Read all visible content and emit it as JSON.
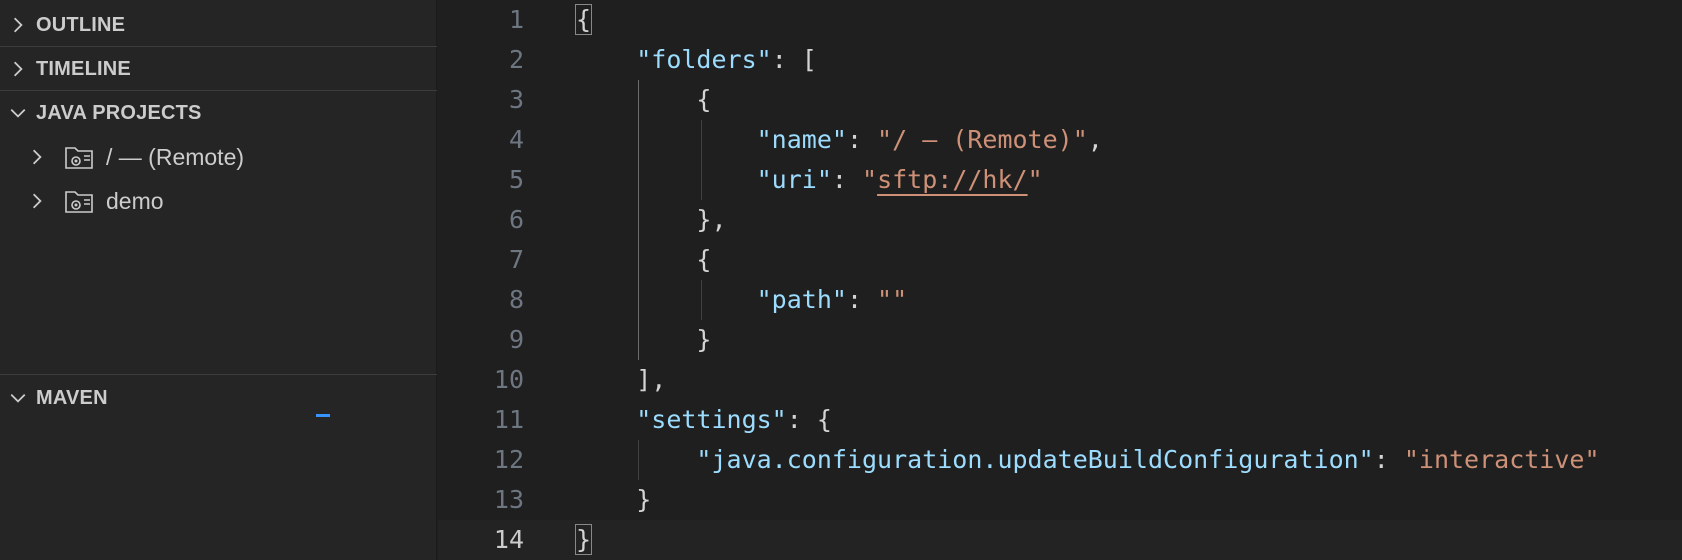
{
  "sidebar": {
    "sections": [
      {
        "label": "OUTLINE",
        "expanded": false
      },
      {
        "label": "TIMELINE",
        "expanded": false
      },
      {
        "label": "JAVA PROJECTS",
        "expanded": true
      },
      {
        "label": "MAVEN",
        "expanded": true
      }
    ],
    "java_projects": [
      {
        "label": "/ — (Remote)",
        "icon": "folder-remote-icon"
      },
      {
        "label": "demo",
        "icon": "folder-remote-icon"
      }
    ]
  },
  "editor": {
    "current_line": 14,
    "lines": [
      {
        "n": "1",
        "tokens": [
          {
            "t": "{",
            "c": "p"
          }
        ]
      },
      {
        "n": "2",
        "tokens": [
          {
            "t": "    "
          },
          {
            "t": "\"folders\"",
            "c": "k"
          },
          {
            "t": ": [",
            "c": "p"
          }
        ]
      },
      {
        "n": "3",
        "tokens": [
          {
            "t": "        {",
            "c": "p"
          }
        ]
      },
      {
        "n": "4",
        "tokens": [
          {
            "t": "            "
          },
          {
            "t": "\"name\"",
            "c": "k"
          },
          {
            "t": ": ",
            "c": "p"
          },
          {
            "t": "\"/ — (Remote)\"",
            "c": "s"
          },
          {
            "t": ",",
            "c": "p"
          }
        ]
      },
      {
        "n": "5",
        "tokens": [
          {
            "t": "            "
          },
          {
            "t": "\"uri\"",
            "c": "k"
          },
          {
            "t": ": ",
            "c": "p"
          },
          {
            "t": "\"",
            "c": "s"
          },
          {
            "t": "sftp://hk/",
            "c": "s link"
          },
          {
            "t": "\"",
            "c": "s"
          }
        ]
      },
      {
        "n": "6",
        "tokens": [
          {
            "t": "        },",
            "c": "p"
          }
        ]
      },
      {
        "n": "7",
        "tokens": [
          {
            "t": "        {",
            "c": "p"
          }
        ]
      },
      {
        "n": "8",
        "tokens": [
          {
            "t": "            "
          },
          {
            "t": "\"path\"",
            "c": "k"
          },
          {
            "t": ": ",
            "c": "p"
          },
          {
            "t": "\"\"",
            "c": "s"
          }
        ]
      },
      {
        "n": "9",
        "tokens": [
          {
            "t": "        }",
            "c": "p"
          }
        ]
      },
      {
        "n": "10",
        "tokens": [
          {
            "t": "    ],",
            "c": "p"
          }
        ]
      },
      {
        "n": "11",
        "tokens": [
          {
            "t": "    "
          },
          {
            "t": "\"settings\"",
            "c": "k"
          },
          {
            "t": ": {",
            "c": "p"
          }
        ]
      },
      {
        "n": "12",
        "tokens": [
          {
            "t": "        "
          },
          {
            "t": "\"java.configuration.updateBuildConfiguration\"",
            "c": "k"
          },
          {
            "t": ": ",
            "c": "p"
          },
          {
            "t": "\"interactive\"",
            "c": "s"
          }
        ]
      },
      {
        "n": "13",
        "tokens": [
          {
            "t": "    }",
            "c": "p"
          }
        ]
      },
      {
        "n": "14",
        "tokens": [
          {
            "t": "}",
            "c": "p"
          }
        ]
      }
    ]
  }
}
